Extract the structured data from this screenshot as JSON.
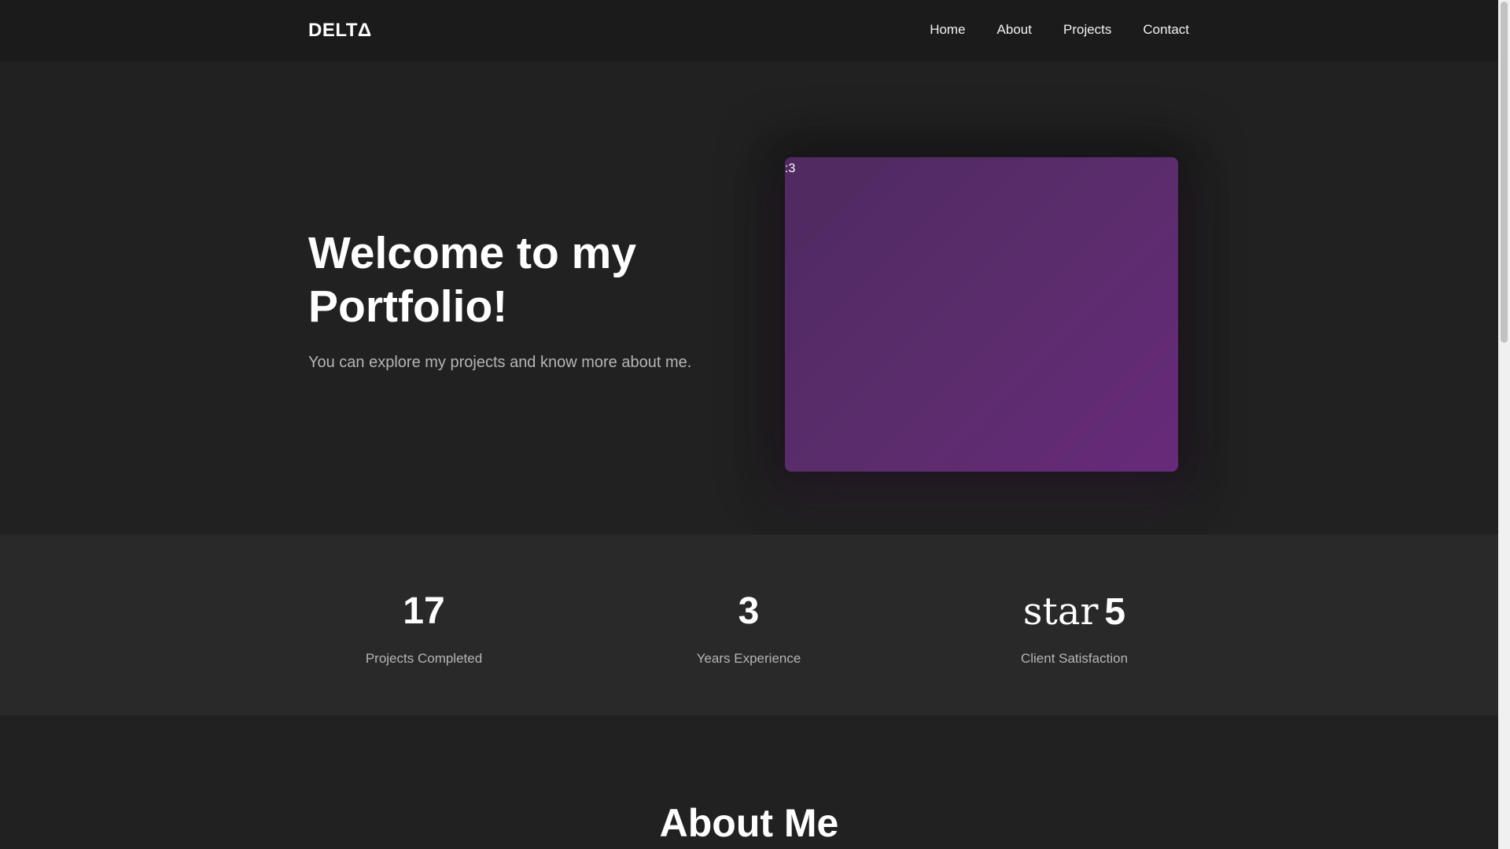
{
  "navbar": {
    "brand": "DELTΔ",
    "links": [
      "Home",
      "About",
      "Projects",
      "Contact"
    ]
  },
  "hero": {
    "title": "Welcome to my Portfolio!",
    "subtitle": "You can explore my projects and know more about me.",
    "image_label": ":3",
    "image_colors": [
      "#4f2a60",
      "#672a7a"
    ]
  },
  "stats": [
    {
      "value": "17",
      "label": "Projects Completed"
    },
    {
      "value": "3",
      "label": "Years Experience"
    },
    {
      "icon_text": "star",
      "value": "5",
      "label": "Client Satisfaction"
    }
  ],
  "about": {
    "title": "About Me"
  },
  "colors": {
    "background": "#212121",
    "navbar": "#1b1b1b",
    "stats_band": "#292929",
    "muted_text": "#b5b5b5"
  }
}
